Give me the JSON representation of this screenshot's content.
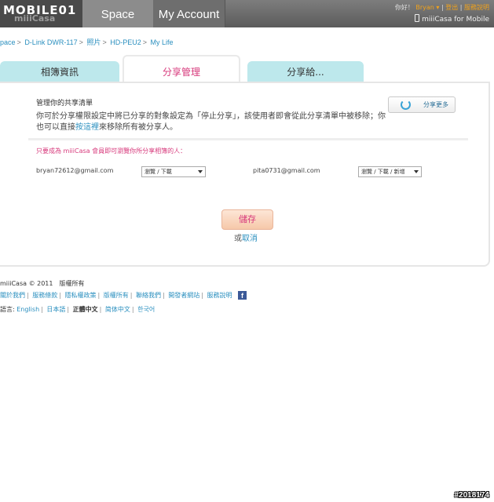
{
  "header": {
    "logo_text": "MOBILE01",
    "logo_sub": "miiiCasa",
    "nav": [
      "Space",
      "My Account"
    ],
    "greeting": "你好！",
    "user": "Bryan",
    "logout": "登出",
    "help": "服務說明",
    "mobile_link": "miiiCasa for Mobile"
  },
  "breadcrumb": [
    "pace",
    "D-Link DWR-117",
    "照片",
    "HD-PEU2",
    "My Life"
  ],
  "tabs": [
    "相簿資訊",
    "分享管理",
    "分享給..."
  ],
  "panel": {
    "title": "管理你的共享清單",
    "desc_before": "你可於分享權限設定中將已分享的對象設定為「停止分享」，該使用者即會從此分享清單中被移除；你也可以直接",
    "desc_link": "按這裡",
    "desc_after": "來移除所有被分享人。",
    "share_more": "分享更多",
    "notice": "只要成為 miiiCasa 會員即可瀏覽你所分享相簿的人：",
    "members": [
      {
        "email": "bryan72612@gmail.com",
        "permission": "瀏覽 / 下載"
      },
      {
        "email": "pita0731@gmail.com",
        "permission": "瀏覽 / 下載 / 新增"
      }
    ],
    "save": "儲存",
    "or": "或",
    "cancel": "取消"
  },
  "footer": {
    "copyright": "miiiCasa © 2011　版權所有",
    "links": [
      "關於我們",
      "服務條款",
      "隱私權政策",
      "版權所有",
      "聯絡我們",
      "開發者網站",
      "服務說明"
    ],
    "lang_label": "語言:",
    "languages": [
      "English",
      "日本語",
      "正體中文",
      "简体中文",
      "한국어"
    ],
    "current_language": "正體中文"
  },
  "watermark": "#2018174",
  "colors": {
    "accent_pink": "#d7387b",
    "link_blue": "#2a8fbf",
    "tab_bg": "#bde8ec",
    "user_orange": "#f2a31b"
  }
}
